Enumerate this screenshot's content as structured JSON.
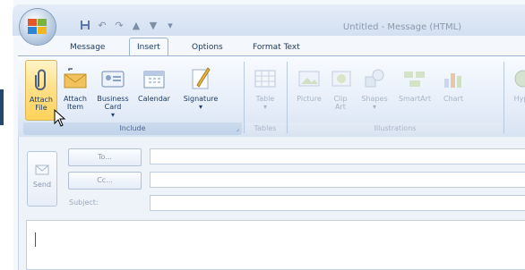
{
  "window": {
    "title": "Untitled - Message (HTML)"
  },
  "quick_access": {
    "icons": [
      "save-icon",
      "undo-icon",
      "redo-icon",
      "up-icon",
      "down-icon",
      "customize-icon"
    ]
  },
  "tabs": [
    {
      "label": "Message",
      "active": false
    },
    {
      "label": "Insert",
      "active": true
    },
    {
      "label": "Options",
      "active": false
    },
    {
      "label": "Format Text",
      "active": false
    }
  ],
  "ribbon": {
    "include": {
      "label": "Include",
      "attach_file": "Attach File",
      "attach_item": "Attach Item",
      "business_card_1": "Business",
      "business_card_2": "Card",
      "calendar": "Calendar",
      "signature": "Signature"
    },
    "tables": {
      "label": "Tables",
      "table": "Table"
    },
    "illustrations": {
      "label": "Illustrations",
      "picture": "Picture",
      "clip_art": "Clip Art",
      "shapes": "Shapes",
      "smartart": "SmartArt",
      "chart": "Chart"
    },
    "links": {
      "hyperlink": "Hype"
    }
  },
  "compose": {
    "send": "Send",
    "to": "To...",
    "cc": "Cc...",
    "subject": "Subject:"
  },
  "colors": {
    "accent": "#1e3c64",
    "hover": "#ffd35a"
  }
}
